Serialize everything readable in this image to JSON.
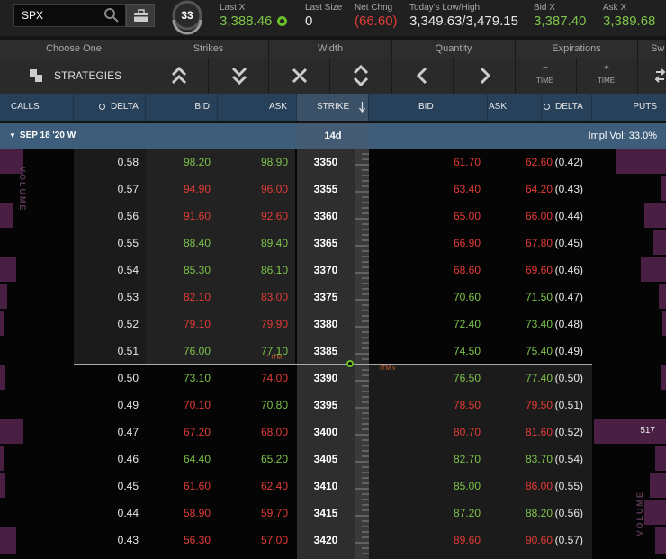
{
  "search": {
    "symbol": "SPX"
  },
  "clock": {
    "value": "33"
  },
  "quotes": [
    {
      "label": "Last X",
      "value": "3,388.46",
      "color": "green"
    },
    {
      "label": "Last Size",
      "value": "0",
      "color": "white"
    },
    {
      "label": "Net Chng",
      "value": "(66.60)",
      "color": "red"
    },
    {
      "label": "Today's Low/High",
      "value": "3,349.63/3,479.15",
      "color": "white"
    },
    {
      "label": "Bid X",
      "value": "3,387.40",
      "color": "green"
    },
    {
      "label": "Ask X",
      "value": "3,389.68",
      "color": "green"
    }
  ],
  "header1": [
    "Choose One",
    "Strikes",
    "Width",
    "Quantity",
    "Expirations",
    "Sw"
  ],
  "header2": {
    "strategies": "STRATEGIES",
    "time_minus": "TIME",
    "time_plus": "TIME",
    "minus_sign": "−",
    "plus_sign": "+"
  },
  "columns": {
    "calls": "CALLS",
    "delta": "DELTA",
    "bid": "BID",
    "ask": "ASK",
    "strike": "STRIKE",
    "pbid": "BID",
    "pask": "ASK",
    "pdelta": "DELTA",
    "puts": "PUTS"
  },
  "expiry": {
    "label": "SEP 18 '20 W",
    "days": "14d",
    "impl_vol": "Impl Vol: 33.0%"
  },
  "volume_label": "VOLUME",
  "itm_labels": {
    "call": "^ ITM",
    "put": "ITM v"
  },
  "highlighted_put_volume": "517",
  "rows": [
    {
      "strike": "3350",
      "c_delta": "0.58",
      "c_bid": "98.20",
      "c_ask": "98.90",
      "c_bid_col": "green",
      "c_ask_col": "green",
      "p_bid": "61.70",
      "p_ask": "62.60",
      "p_bid_col": "red",
      "p_ask_col": "red",
      "p_delta": "(0.42)"
    },
    {
      "strike": "3355",
      "c_delta": "0.57",
      "c_bid": "94.90",
      "c_ask": "96.00",
      "c_bid_col": "red",
      "c_ask_col": "red",
      "p_bid": "63.40",
      "p_ask": "64.20",
      "p_bid_col": "red",
      "p_ask_col": "red",
      "p_delta": "(0.43)"
    },
    {
      "strike": "3360",
      "c_delta": "0.56",
      "c_bid": "91.60",
      "c_ask": "92.60",
      "c_bid_col": "red",
      "c_ask_col": "red",
      "p_bid": "65.00",
      "p_ask": "66.00",
      "p_bid_col": "red",
      "p_ask_col": "red",
      "p_delta": "(0.44)"
    },
    {
      "strike": "3365",
      "c_delta": "0.55",
      "c_bid": "88.40",
      "c_ask": "89.40",
      "c_bid_col": "green",
      "c_ask_col": "green",
      "p_bid": "66.90",
      "p_ask": "67.80",
      "p_bid_col": "red",
      "p_ask_col": "red",
      "p_delta": "(0.45)"
    },
    {
      "strike": "3370",
      "c_delta": "0.54",
      "c_bid": "85.30",
      "c_ask": "86.10",
      "c_bid_col": "green",
      "c_ask_col": "green",
      "p_bid": "68.60",
      "p_ask": "69.60",
      "p_bid_col": "red",
      "p_ask_col": "red",
      "p_delta": "(0.46)"
    },
    {
      "strike": "3375",
      "c_delta": "0.53",
      "c_bid": "82.10",
      "c_ask": "83.00",
      "c_bid_col": "red",
      "c_ask_col": "red",
      "p_bid": "70.60",
      "p_ask": "71.50",
      "p_bid_col": "green",
      "p_ask_col": "green",
      "p_delta": "(0.47)"
    },
    {
      "strike": "3380",
      "c_delta": "0.52",
      "c_bid": "79.10",
      "c_ask": "79.90",
      "c_bid_col": "red",
      "c_ask_col": "red",
      "p_bid": "72.40",
      "p_ask": "73.40",
      "p_bid_col": "green",
      "p_ask_col": "green",
      "p_delta": "(0.48)"
    },
    {
      "strike": "3385",
      "c_delta": "0.51",
      "c_bid": "76.00",
      "c_ask": "77.10",
      "c_bid_col": "green",
      "c_ask_col": "green",
      "p_bid": "74.50",
      "p_ask": "75.40",
      "p_bid_col": "green",
      "p_ask_col": "green",
      "p_delta": "(0.49)"
    },
    {
      "strike": "3390",
      "c_delta": "0.50",
      "c_bid": "73.10",
      "c_ask": "74.00",
      "c_bid_col": "green",
      "c_ask_col": "red",
      "p_bid": "76.50",
      "p_ask": "77.40",
      "p_bid_col": "green",
      "p_ask_col": "green",
      "p_delta": "(0.50)"
    },
    {
      "strike": "3395",
      "c_delta": "0.49",
      "c_bid": "70.10",
      "c_ask": "70.80",
      "c_bid_col": "red",
      "c_ask_col": "green",
      "p_bid": "78.50",
      "p_ask": "79.50",
      "p_bid_col": "red",
      "p_ask_col": "red",
      "p_delta": "(0.51)"
    },
    {
      "strike": "3400",
      "c_delta": "0.47",
      "c_bid": "67.20",
      "c_ask": "68.00",
      "c_bid_col": "red",
      "c_ask_col": "red",
      "p_bid": "80.70",
      "p_ask": "81.60",
      "p_bid_col": "red",
      "p_ask_col": "red",
      "p_delta": "(0.52)"
    },
    {
      "strike": "3405",
      "c_delta": "0.46",
      "c_bid": "64.40",
      "c_ask": "65.20",
      "c_bid_col": "green",
      "c_ask_col": "green",
      "p_bid": "82.70",
      "p_ask": "83.70",
      "p_bid_col": "green",
      "p_ask_col": "green",
      "p_delta": "(0.54)"
    },
    {
      "strike": "3410",
      "c_delta": "0.45",
      "c_bid": "61.60",
      "c_ask": "62.40",
      "c_bid_col": "red",
      "c_ask_col": "red",
      "p_bid": "85.00",
      "p_ask": "86.00",
      "p_bid_col": "green",
      "p_ask_col": "red",
      "p_delta": "(0.55)"
    },
    {
      "strike": "3415",
      "c_delta": "0.44",
      "c_bid": "58.90",
      "c_ask": "59.70",
      "c_bid_col": "red",
      "c_ask_col": "red",
      "p_bid": "87.20",
      "p_ask": "88.20",
      "p_bid_col": "green",
      "p_ask_col": "green",
      "p_delta": "(0.56)"
    },
    {
      "strike": "3420",
      "c_delta": "0.43",
      "c_bid": "56.30",
      "c_ask": "57.00",
      "c_bid_col": "red",
      "c_ask_col": "red",
      "p_bid": "89.60",
      "p_ask": "90.60",
      "p_bid_col": "red",
      "p_ask_col": "red",
      "p_delta": "(0.57)"
    }
  ]
}
